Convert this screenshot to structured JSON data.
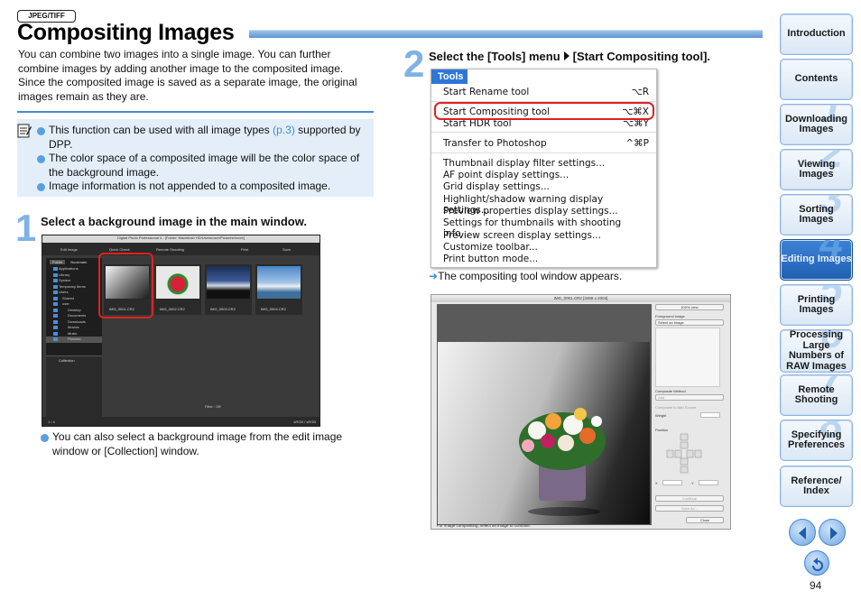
{
  "header": {
    "tag": "JPEG/TIFF",
    "title": "Compositing Images"
  },
  "intro": "You can combine two images into a single image. You can further combine images by adding another image to the composited image. Since the composited image is saved as a separate image, the original images remain as they are.",
  "notes": [
    {
      "pre": "This function can be used with all image types ",
      "link": "(p.3)",
      "post": " supported by DPP."
    },
    {
      "pre": "The color space of a composited image will be the color space of the background image.",
      "link": "",
      "post": ""
    },
    {
      "pre": "Image information is not appended to a composited image.",
      "link": "",
      "post": ""
    }
  ],
  "step1": {
    "num": "1",
    "text": "Select a background image in the main window.",
    "bullet": "You can also select a background image from the edit image window or [Collection] window."
  },
  "step2": {
    "num": "2",
    "text_a": "Select the [Tools] menu",
    "text_b": "[Start Compositing tool].",
    "result": "The compositing tool window appears."
  },
  "tools_menu": {
    "header": "Tools",
    "items": [
      {
        "label": "Start Rename tool",
        "shortcut": "⌥R"
      },
      {
        "label": "Start Compositing tool",
        "shortcut": "⌥⌘X"
      },
      {
        "label": "Start HDR tool",
        "shortcut": "⌥⌘Y"
      },
      {
        "label": "Transfer to Photoshop",
        "shortcut": "^⌘P"
      },
      {
        "label": "Thumbnail display filter settings...",
        "shortcut": ""
      },
      {
        "label": "AF point display settings...",
        "shortcut": ""
      },
      {
        "label": "Grid display settings...",
        "shortcut": ""
      },
      {
        "label": "Highlight/shadow warning display settings...",
        "shortcut": ""
      },
      {
        "label": "Preview properties display settings...",
        "shortcut": ""
      },
      {
        "label": "Settings for thumbnails with shooting info...",
        "shortcut": ""
      },
      {
        "label": "Preview screen display settings...",
        "shortcut": ""
      },
      {
        "label": "Customize toolbar...",
        "shortcut": ""
      },
      {
        "label": "Print button mode...",
        "shortcut": ""
      }
    ]
  },
  "dpp_window": {
    "title": "Digital Photo Professional 4 - [Folder: Macintosh HD/Users/user/Pictures/xxxxx]",
    "toolbar": [
      "Edit image",
      "Quick Check",
      "Remote Shooting",
      "Print",
      "Save"
    ],
    "tabs": [
      "Folder",
      "Bookmark"
    ],
    "folders": [
      "Applications",
      "Library",
      "System",
      "Temporary Items",
      "Users",
      "Shared",
      "user",
      "Desktop",
      "Documents",
      "Downloads",
      "Movies",
      "Music",
      "Pictures"
    ],
    "collection": "Collection",
    "add_collection": "+ Add collection",
    "thumbs": [
      "IMG_0001.CR2",
      "IMG_0002.CR2",
      "IMG_0003.CR2",
      "IMG_0004.CR2"
    ],
    "status_left": "1 / 4",
    "status_right": "sRGB / sRGB",
    "filter": "Filter : Off"
  },
  "comp_window": {
    "title": "IMG_0001.CR2 [3456 x 2304]",
    "view_btn": "100% view",
    "fg_label": "Foreground image",
    "fg_select": "Select an image",
    "method_label": "Composite Method",
    "method_select": "Add",
    "chk": "Composite to Add Source",
    "weight": "Weight",
    "position": "Position",
    "x": "X",
    "y": "Y",
    "continue": "Continue",
    "save": "Save As...",
    "close": "Close",
    "status": "For image compositing, select an image to combine."
  },
  "nav": [
    {
      "label": "Introduction",
      "num": ""
    },
    {
      "label": "Contents",
      "num": ""
    },
    {
      "label": "Downloading Images",
      "num": "1"
    },
    {
      "label": "Viewing Images",
      "num": "2"
    },
    {
      "label": "Sorting Images",
      "num": "3"
    },
    {
      "label": "Editing Images",
      "num": "4"
    },
    {
      "label": "Printing Images",
      "num": "5"
    },
    {
      "label": "Processing Large Numbers of RAW Images",
      "num": "6"
    },
    {
      "label": "Remote Shooting",
      "num": "7"
    },
    {
      "label": "Specifying Preferences",
      "num": "8"
    },
    {
      "label": "Reference/ Index",
      "num": ""
    }
  ],
  "page_number": "94"
}
